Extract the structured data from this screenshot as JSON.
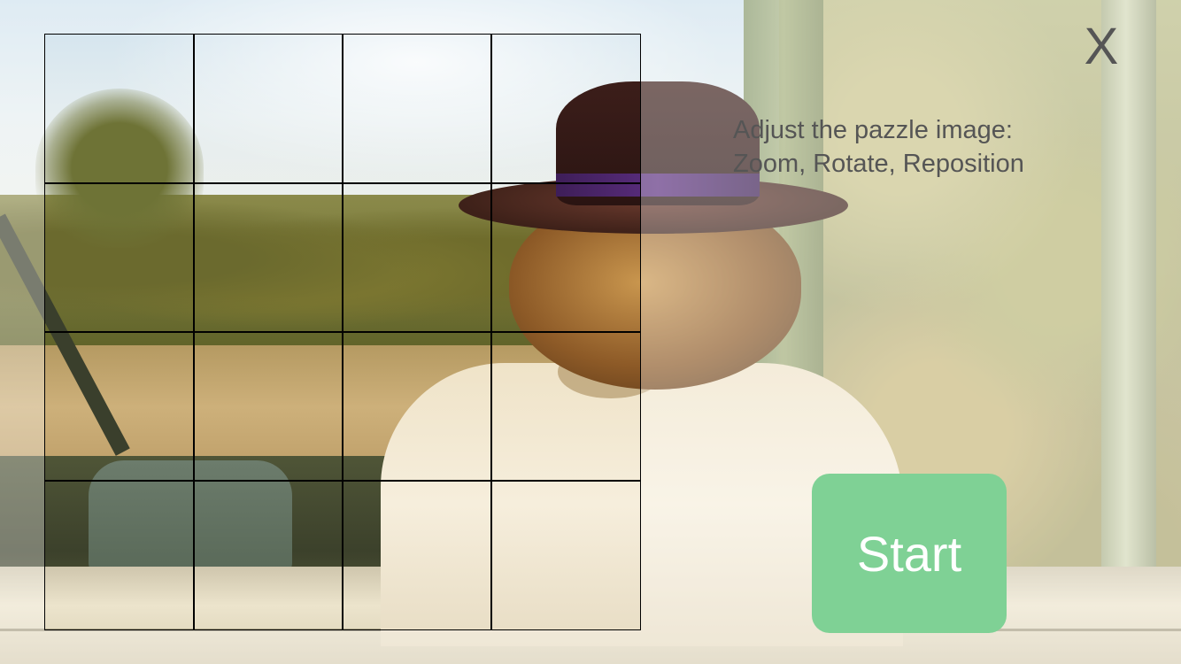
{
  "controls": {
    "close_label": "X",
    "start_label": "Start"
  },
  "instructions": {
    "line1": "Adjust the pazzle image:",
    "line2": "Zoom, Rotate, Reposition"
  },
  "puzzle": {
    "rows": 4,
    "cols": 4
  },
  "colors": {
    "start_button": "#7fd195",
    "text": "#555555",
    "grid_lines": "#000000"
  },
  "icons": {
    "close": "close-icon"
  }
}
